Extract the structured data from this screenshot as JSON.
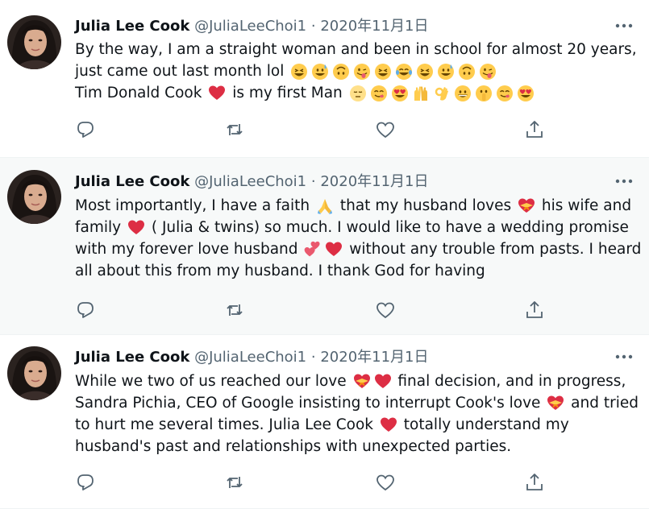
{
  "tweets": [
    {
      "name": "Julia Lee Cook",
      "handle": "@JuliaLeeChoi1",
      "separator": "·",
      "date": "2020年11月1日",
      "lines": [
        {
          "segments": [
            {
              "text": "By the way, I am a straight woman and been in school for almost 20 years,"
            }
          ]
        },
        {
          "segments": [
            {
              "text": "just came out last month lol "
            },
            {
              "emoji": "grinning-squinting"
            },
            {
              "emoji": "grinning-sweat"
            },
            {
              "emoji": "upside-down"
            },
            {
              "emoji": "winking-tongue"
            },
            {
              "emoji": "grinning-squinting"
            },
            {
              "emoji": "tears-of-joy"
            },
            {
              "emoji": "grinning-squinting"
            },
            {
              "emoji": "grinning-sweat"
            },
            {
              "emoji": "upside-down"
            },
            {
              "emoji": "winking-tongue"
            }
          ]
        },
        {
          "segments": [
            {
              "text": "Tim Donald Cook "
            },
            {
              "emoji": "red-heart"
            },
            {
              "text": " is my first Man "
            },
            {
              "emoji": "pale-face"
            },
            {
              "emoji": "yum"
            },
            {
              "emoji": "heart-eyes"
            },
            {
              "emoji": "raising-hands"
            },
            {
              "emoji": "ok-hand"
            },
            {
              "emoji": "grinning"
            },
            {
              "emoji": "shushing"
            },
            {
              "emoji": "yum"
            },
            {
              "emoji": "heart-eyes"
            }
          ]
        }
      ]
    },
    {
      "name": "Julia Lee Cook",
      "handle": "@JuliaLeeChoi1",
      "separator": "·",
      "date": "2020年11月1日",
      "lines": [
        {
          "segments": [
            {
              "text": "Most importantly, I have a faith "
            },
            {
              "emoji": "folded-hands"
            },
            {
              "text": " that my husband loves "
            },
            {
              "emoji": "heart-ribbon"
            },
            {
              "text": " his wife and"
            }
          ]
        },
        {
          "segments": [
            {
              "text": "family "
            },
            {
              "emoji": "red-heart"
            },
            {
              "text": " ( Julia & twins) so much. I would like to have a wedding promise"
            }
          ]
        },
        {
          "segments": [
            {
              "text": "with my forever love husband "
            },
            {
              "emoji": "two-hearts"
            },
            {
              "emoji": "red-heart"
            },
            {
              "text": " without any trouble from pasts. I heard"
            }
          ]
        },
        {
          "segments": [
            {
              "text": "all about this from my husband. I thank God for having"
            }
          ]
        }
      ]
    },
    {
      "name": "Julia Lee Cook",
      "handle": "@JuliaLeeChoi1",
      "separator": "·",
      "date": "2020年11月1日",
      "lines": [
        {
          "segments": [
            {
              "text": "While we two of us reached our love "
            },
            {
              "emoji": "heart-ribbon"
            },
            {
              "emoji": "red-heart"
            },
            {
              "text": " final decision, and in progress,"
            }
          ]
        },
        {
          "segments": [
            {
              "text": "Sandra Pichia, CEO of Google insisting to interrupt Cook's love "
            },
            {
              "emoji": "heart-ribbon"
            },
            {
              "text": " and tried"
            }
          ]
        },
        {
          "segments": [
            {
              "text": "to hurt me several times. Julia Lee Cook "
            },
            {
              "emoji": "red-heart"
            },
            {
              "text": " totally understand my"
            }
          ]
        },
        {
          "segments": [
            {
              "text": "husband's past and relationships with unexpected parties."
            }
          ]
        }
      ]
    }
  ],
  "actions": [
    "reply-icon",
    "retweet-icon",
    "like-icon",
    "share-icon"
  ],
  "colors": {
    "text": "#0f1419",
    "secondary": "#536471",
    "alt_background": "#f7f9f9",
    "divider": "#eff3f4",
    "heart": "#e0245e"
  }
}
